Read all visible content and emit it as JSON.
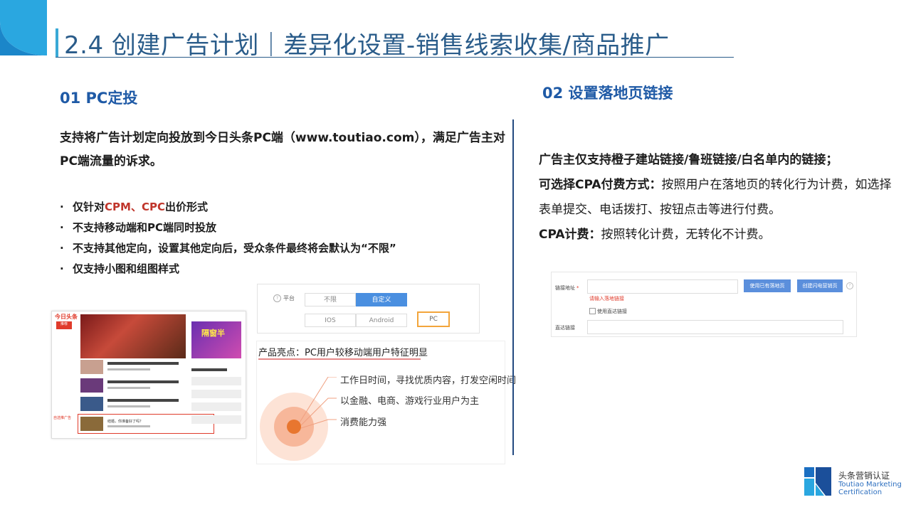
{
  "slide": {
    "title": "2.4 创建广告计划｜差异化设置-销售线索收集/商品推广"
  },
  "left": {
    "heading": "01 PC定投",
    "intro": "支持将广告计划定向投放到今日头条PC端（www.toutiao.com），满足广告主对PC端流量的诉求。",
    "bullet_symbol": "·",
    "bullets": [
      {
        "pre": "仅针对",
        "hl": "CPM、CPC",
        "post": "出价形式"
      },
      {
        "pre": "不支持移动端和PC端同时投放",
        "hl": "",
        "post": ""
      },
      {
        "pre": "不支持其他定向，设置其他定向后，受众条件最终将会默认为“不限”",
        "hl": "",
        "post": ""
      },
      {
        "pre": "仅支持小图和组图样式",
        "hl": "",
        "post": ""
      }
    ]
  },
  "mock_page": {
    "logo": "今日头条",
    "nav_active": "推荐",
    "ad_label": "自选推广告",
    "ad_text": "隔窗半",
    "item_caption": "结婚，你准备好了吗？"
  },
  "platform_panel": {
    "label": "平台",
    "row1": [
      "不限",
      "自定义"
    ],
    "row2": [
      "IOS",
      "Android",
      "PC"
    ],
    "selected": "自定义",
    "highlighted": "PC"
  },
  "product_panel": {
    "title": "产品亮点：PC用户较移动端用户特征明显",
    "items": [
      "工作日时间，寻找优质内容，打发空闲时间",
      "以金融、电商、游戏行业用户为主",
      "消费能力强"
    ],
    "colors": {
      "outer": "#fde3d6",
      "mid": "#f7b79a",
      "core": "#e8762f",
      "line": "#f0a080"
    }
  },
  "right": {
    "heading": "02 设置落地页链接",
    "line1": "广告主仅支持橙子建站链接/鲁班链接/白名单内的链接；",
    "cpa_pay_bold": "可选择CPA付费方式：",
    "cpa_pay_text": "按照用户在落地页的转化行为计费，如选择表单提交、电话拨打、按钮点击等进行付费。",
    "cpa_fee_bold": "CPA计费：",
    "cpa_fee_text": "按照转化计费，无转化不计费。"
  },
  "link_panel": {
    "link_label": "链接地址",
    "required_mark": "*",
    "btn_existing": "使用已有落地页",
    "btn_create": "创建闪电营销页",
    "error": "请输入落地链接",
    "checkbox_label": "使用直达链接",
    "direct_label": "直达链接"
  },
  "brand": {
    "cn": "头条营销认证",
    "en1": "Toutiao Marketing",
    "en2": "Certification"
  },
  "colors": {
    "title": "#2a5c8a",
    "heading": "#1f5aa6",
    "highlight": "#c0352b",
    "divider": "#234a80",
    "accent": "#3aa9d6"
  }
}
